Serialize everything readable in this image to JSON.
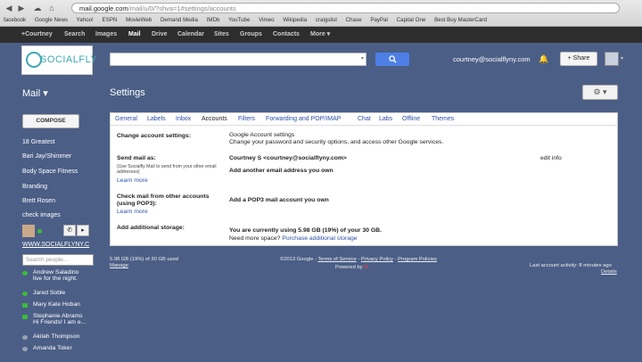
{
  "browser": {
    "url_host": "mail.google.com",
    "url_path": "/mail/u/0/?shva=1#settings/accounts",
    "bookmarks": [
      "facebook",
      "Google News",
      "Yahoo!",
      "ESPN",
      "MovieWeb",
      "Demand Media",
      "IMDb",
      "YouTube",
      "Vimeo",
      "Wikipedia",
      "craigslist",
      "Chase",
      "PayPal",
      "Capital One",
      "Best Buy MasterCard"
    ]
  },
  "gbar": [
    "+Courtney",
    "Search",
    "Images",
    "Mail",
    "Drive",
    "Calendar",
    "Sites",
    "Groups",
    "Contacts",
    "More ▾"
  ],
  "header": {
    "logo_text": "SOCIALFLY",
    "email": "courtney@socialflyny.com",
    "share_label": "+ Share"
  },
  "nav": {
    "mail_label": "Mail ▾",
    "settings_title": "Settings",
    "compose_label": "COMPOSE",
    "labels": [
      "18 Greatest",
      "Bari Jay/Shimmer",
      "Body Space Fitness",
      "Branding",
      "Brett Rosen",
      "check images"
    ],
    "social_link": "WWW.SOCIALFLYNY.C",
    "people_placeholder": "Search people...",
    "contacts": [
      {
        "name": "Andrew Saladino",
        "status": "live for the night.",
        "color": "#3cbb3c"
      },
      {
        "name": "Jared Soble",
        "status": "",
        "color": "#3cbb3c"
      },
      {
        "name": "Mary Kate Hoban",
        "status": "",
        "color": "#3cbb3c"
      },
      {
        "name": "Stephanie Abrams",
        "status": "Hi Friends! I am e...",
        "color": "#3cbb3c"
      },
      {
        "name": "Akilah Thompson",
        "status": "",
        "color": "#9aa3b5"
      },
      {
        "name": "Amanda Toker",
        "status": "",
        "color": "#9aa3b5"
      }
    ]
  },
  "tabs": [
    "General",
    "Labels",
    "Inbox",
    "Accounts",
    "Filters",
    "Forwarding and POP/IMAP",
    "Chat",
    "Labs",
    "Offline",
    "Themes"
  ],
  "active_tab": "Accounts",
  "settings": {
    "change_label": "Change account settings:",
    "change_link": "Google Account settings",
    "change_desc": "Change your password and security options, and access other Google services.",
    "send_label": "Send mail as:",
    "send_note": "(Use Socialfly Mail to send from your other email addresses)",
    "send_learn": "Learn more",
    "send_value": "Courtney S <courtney@socialflyny.com>",
    "send_add": "Add another email address you own",
    "send_edit": "edit info",
    "check_label": "Check mail from other accounts (using POP3):",
    "check_learn": "Learn more",
    "check_add": "Add a POP3 mail account you own",
    "storage_label": "Add additional storage:",
    "storage_value": "You are currently using 5.98 GB (19%) of your 30 GB.",
    "storage_q": "Need more space?",
    "storage_link": "Purchase additional storage"
  },
  "footer": {
    "usage": "5.98 GB (19%) of 30 GB used",
    "manage": "Manage",
    "copyright": "©2013 Google -",
    "tos": "Terms of Service",
    "privacy": "Privacy Policy",
    "programs": "Program Policies",
    "powered": "Powered by",
    "activity": "Last account activity: 8 minutes ago",
    "details": "Details"
  }
}
